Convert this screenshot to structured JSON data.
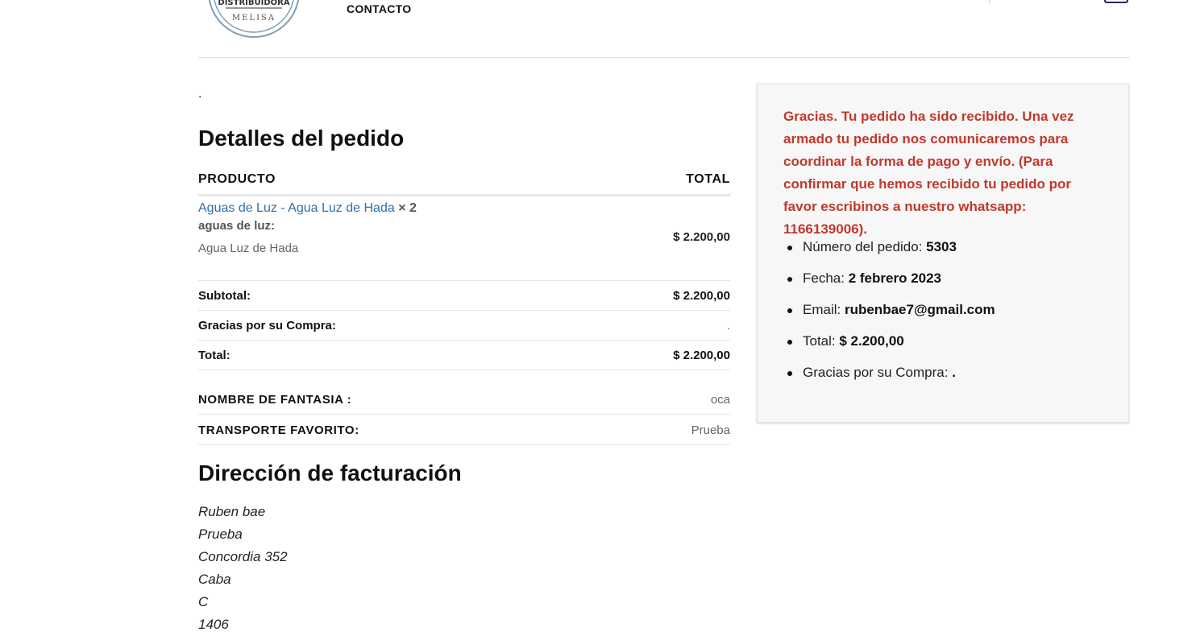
{
  "header": {
    "logo_text_top": "DISTRIBUIDORA",
    "logo_text_bottom": "MELISA",
    "nav_contact": "CONTACTO"
  },
  "main": {
    "dot": ".",
    "details_title": "Detalles del pedido",
    "table": {
      "col_product": "PRODUCTO",
      "col_total": "TOTAL",
      "item": {
        "name": "Aguas de Luz - Agua Luz de Hada",
        "qty": "× 2",
        "meta_key": "aguas de luz:",
        "meta_value": "Agua Luz de Hada",
        "price": "$ 2.200,00"
      },
      "subtotal_label": "Subtotal:",
      "subtotal_value": "$ 2.200,00",
      "gracias_label": "Gracias por su Compra:",
      "gracias_value": ".",
      "total_label": "Total:",
      "total_value": "$ 2.200,00"
    },
    "extra": {
      "fantasia_label": "NOMBRE DE FANTASIA :",
      "fantasia_value": "oca",
      "transporte_label": "TRANSPORTE FAVORITO:",
      "transporte_value": "Prueba"
    },
    "billing_title": "Dirección de facturación",
    "billing_lines": [
      "Ruben bae",
      "Prueba",
      "Concordia 352",
      "Caba",
      "C",
      "1406"
    ]
  },
  "panel": {
    "thanks": "Gracias. Tu pedido ha sido recibido. Una vez armado tu pedido nos comunicaremos para coordinar la forma de pago y envío. (Para confirmar que hemos recibido tu pedido por favor escribinos a nuestro whatsapp: 1166139006).",
    "order_number_label": "Número del pedido:",
    "order_number": "5303",
    "date_label": "Fecha:",
    "date": "2 febrero 2023",
    "email_label": "Email:",
    "email": "rubenbae7@gmail.com",
    "total_label": "Total:",
    "total": "$ 2.200,00",
    "gracias_label": "Gracias por su Compra:",
    "gracias_value": "."
  },
  "colors": {
    "accent_red": "#c0392b",
    "link_blue": "#2f6fad",
    "logo_blue": "#7f9fb5"
  }
}
